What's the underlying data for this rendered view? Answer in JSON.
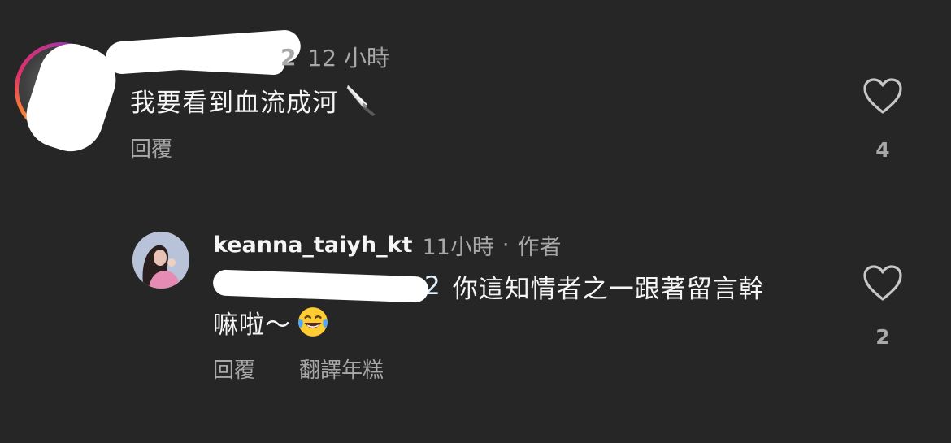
{
  "top_comment": {
    "username_tail": "2",
    "timestamp": "12 小時",
    "text": "我要看到血流成河",
    "emoji": "knife-icon",
    "reply_label": "回覆",
    "like_count": "4"
  },
  "reply_comment": {
    "username": "keanna_taiyh_kt",
    "timestamp": "11小時",
    "separator": "·",
    "author_badge": "作者",
    "mention_tail": "2",
    "text_line1": "你這知情者之一跟著留言幹",
    "text_line2": "嘛啦～",
    "emoji": "laughing-tears-icon",
    "reply_label": "回覆",
    "translate_label": "翻譯年糕",
    "like_count": "2"
  },
  "colors": {
    "background": "#262626",
    "primary_text": "#f5f5f5",
    "secondary_text": "#a8a8a8",
    "mention": "#e0f1ff"
  }
}
